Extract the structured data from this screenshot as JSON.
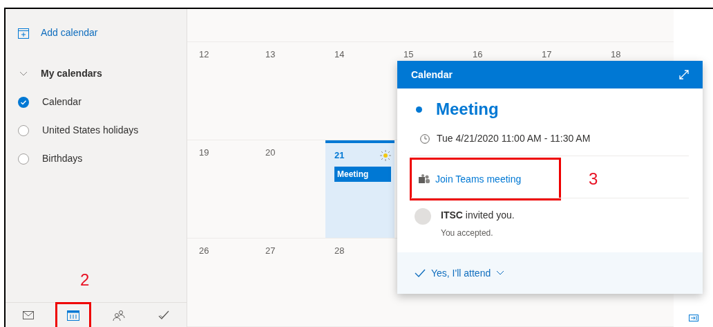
{
  "sidebar": {
    "add_calendar": "Add calendar",
    "group": {
      "label": "My calendars",
      "expanded": true,
      "calendars": [
        {
          "label": "Calendar",
          "checked": true
        },
        {
          "label": "United States holidays",
          "checked": false
        },
        {
          "label": "Birthdays",
          "checked": false
        }
      ]
    }
  },
  "annotations": [
    {
      "label": "2"
    },
    {
      "label": "3"
    }
  ],
  "nav": [
    {
      "kind": "mail",
      "selected": false
    },
    {
      "kind": "calendar",
      "selected": true
    },
    {
      "kind": "people",
      "selected": false
    },
    {
      "kind": "tasks",
      "selected": false
    }
  ],
  "weeks": [
    {
      "days": [
        {
          "label": "12",
          "selected": false
        },
        {
          "label": "13",
          "selected": false
        },
        {
          "label": "14",
          "selected": false
        },
        {
          "label": "15",
          "selected": false
        },
        {
          "label": "16",
          "selected": false
        },
        {
          "label": "17",
          "selected": false
        },
        {
          "label": "18",
          "selected": false
        }
      ]
    },
    {
      "days": [
        {
          "label": "19",
          "selected": false
        },
        {
          "label": "20",
          "selected": false
        },
        {
          "label": "21",
          "selected": true,
          "events": [
            "Meeting"
          ]
        }
      ]
    },
    {
      "days": [
        {
          "label": "26",
          "selected": false
        },
        {
          "label": "27",
          "selected": false
        },
        {
          "label": "28",
          "selected": false
        }
      ]
    }
  ],
  "popup": {
    "header": "Calendar",
    "title": "Meeting",
    "time": "Tue 4/21/2020 11:00 AM - 11:30 AM",
    "join_link": "Join Teams meeting",
    "organizer": "**ITSC** invited you.",
    "response_status": "You accepted.",
    "response_button": "Yes, I'll attend"
  }
}
